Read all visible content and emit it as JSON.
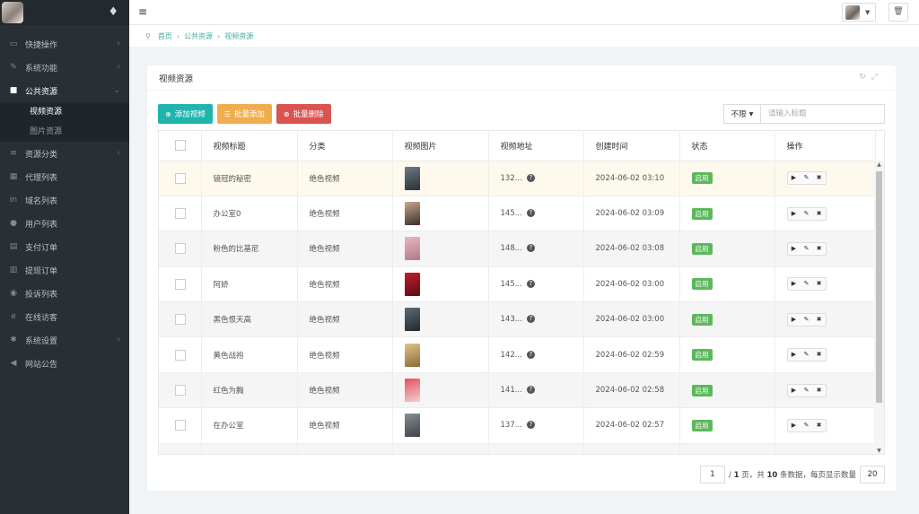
{
  "sidebar": {
    "items": [
      {
        "icon": "folder-open-icon",
        "glyph": "▭",
        "label": "快捷操作",
        "arrow": "‹"
      },
      {
        "icon": "pencil-icon",
        "glyph": "✎",
        "label": "系统功能",
        "arrow": "‹"
      },
      {
        "icon": "video-camera-icon",
        "glyph": "■",
        "label": "公共资源",
        "arrow": "⌄"
      },
      {
        "icon": "list-icon",
        "glyph": "≡",
        "label": "资源分类",
        "arrow": "‹"
      },
      {
        "icon": "group-icon",
        "glyph": "▦",
        "label": "代理列表",
        "arrow": ""
      },
      {
        "icon": "linkedin-icon",
        "glyph": "in",
        "label": "域名列表",
        "arrow": ""
      },
      {
        "icon": "user-icon",
        "glyph": "●",
        "label": "用户列表",
        "arrow": ""
      },
      {
        "icon": "document-icon",
        "glyph": "▤",
        "label": "支付订单",
        "arrow": ""
      },
      {
        "icon": "bank-icon",
        "glyph": "▥",
        "label": "提现订单",
        "arrow": ""
      },
      {
        "icon": "info-circle-icon",
        "glyph": "◉",
        "label": "投诉列表",
        "arrow": ""
      },
      {
        "icon": "ie-icon",
        "glyph": "e",
        "label": "在线访客",
        "arrow": ""
      },
      {
        "icon": "gear-icon",
        "glyph": "✱",
        "label": "系统设置",
        "arrow": "‹"
      },
      {
        "icon": "bullhorn-icon",
        "glyph": "◀",
        "label": "网站公告",
        "arrow": ""
      }
    ],
    "submenu": [
      "视频资源",
      "图片资源"
    ]
  },
  "breadcrumb": [
    "首页",
    "公共资源",
    "视频资源"
  ],
  "panel": {
    "title": "视频资源"
  },
  "toolbar": {
    "add_label": "添加视频",
    "batch_add_label": "批量添加",
    "batch_delete_label": "批量删除"
  },
  "search": {
    "filter_label": "不限",
    "placeholder": "请输入标题"
  },
  "table": {
    "headers": [
      "",
      "视频标题",
      "分类",
      "视频图片",
      "视频地址",
      "创建时间",
      "状态",
      "操作"
    ],
    "rows": [
      {
        "title": "镜冠的秘密",
        "category": "绝色视频",
        "url": "132...",
        "created": "2024-06-02 03:10",
        "status": "启用",
        "thumb": [
          "#6b7b85",
          "#2b3036"
        ]
      },
      {
        "title": "办公室0",
        "category": "绝色视频",
        "url": "145...",
        "created": "2024-06-02 03:09",
        "status": "启用",
        "thumb": [
          "#c8a88a",
          "#3a2e2a"
        ]
      },
      {
        "title": "粉色的比基尼",
        "category": "绝色视频",
        "url": "148...",
        "created": "2024-06-02 03:08",
        "status": "启用",
        "thumb": [
          "#e8b7c2",
          "#b07a86"
        ]
      },
      {
        "title": "阿娇",
        "category": "绝色视频",
        "url": "145...",
        "created": "2024-06-02 03:00",
        "status": "启用",
        "thumb": [
          "#c21d2a",
          "#5a0e14"
        ]
      },
      {
        "title": "黑色恨天高",
        "category": "绝色视频",
        "url": "143...",
        "created": "2024-06-02 03:00",
        "status": "启用",
        "thumb": [
          "#5c6a74",
          "#22282d"
        ]
      },
      {
        "title": "黄色战袍",
        "category": "绝色视频",
        "url": "142...",
        "created": "2024-06-02 02:59",
        "status": "启用",
        "thumb": [
          "#e0c48a",
          "#8a6a3a"
        ]
      },
      {
        "title": "红色为胸",
        "category": "绝色视频",
        "url": "141...",
        "created": "2024-06-02 02:58",
        "status": "启用",
        "thumb": [
          "#e05060",
          "#f3d0cf"
        ]
      },
      {
        "title": "在办公室",
        "category": "绝色视频",
        "url": "137...",
        "created": "2024-06-02 02:57",
        "status": "启用",
        "thumb": [
          "#8a8f96",
          "#3c4248"
        ]
      }
    ]
  },
  "pager": {
    "page": "1",
    "total_pages": "1",
    "text_a": "页，共",
    "total": "10",
    "text_b": "条数据，每页显示数量",
    "page_size": "20"
  },
  "colors": {
    "sidebar": "#283036",
    "teal": "#1fb5ad",
    "yellow": "#f0ad4e",
    "red": "#d9534f",
    "green": "#5cb85c"
  }
}
